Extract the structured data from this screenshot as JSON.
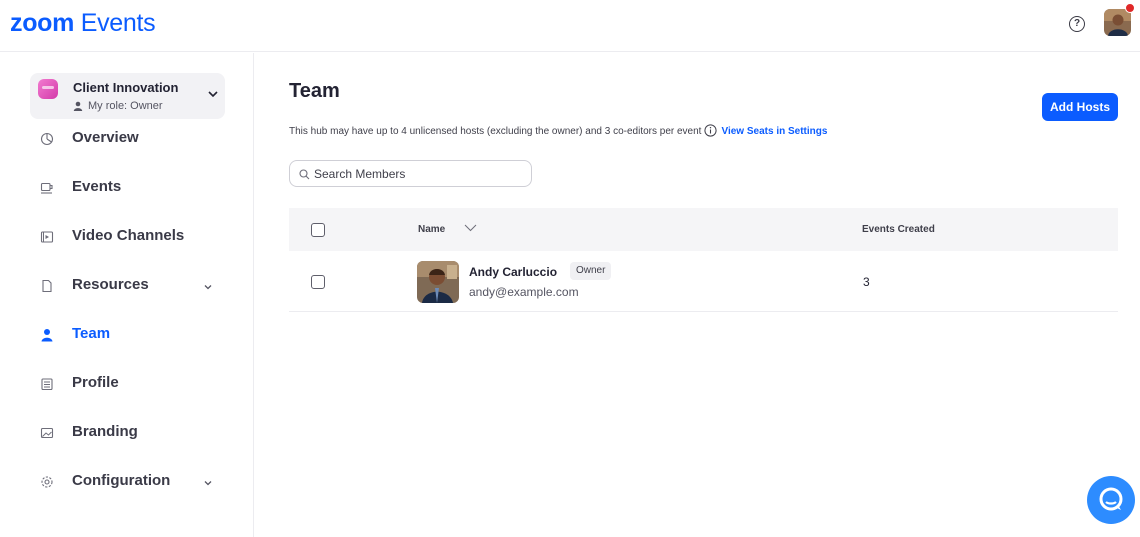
{
  "header": {
    "logo_zoom": "zoom",
    "logo_events": "Events",
    "help_icon": "question-mark",
    "has_notification": true
  },
  "sidebar": {
    "hub": {
      "name": "Client Innovation",
      "role": "My role: Owner"
    },
    "items": [
      {
        "label": "Overview",
        "icon": "pie-chart-icon",
        "active": false,
        "expandable": false
      },
      {
        "label": "Events",
        "icon": "coffee-cup-icon",
        "active": false,
        "expandable": false
      },
      {
        "label": "Video Channels",
        "icon": "video-channel-icon",
        "active": false,
        "expandable": false
      },
      {
        "label": "Resources",
        "icon": "document-icon",
        "active": false,
        "expandable": true
      },
      {
        "label": "Team",
        "icon": "person-icon",
        "active": true,
        "expandable": false
      },
      {
        "label": "Profile",
        "icon": "profile-list-icon",
        "active": false,
        "expandable": false
      },
      {
        "label": "Branding",
        "icon": "image-icon",
        "active": false,
        "expandable": false
      },
      {
        "label": "Configuration",
        "icon": "gear-icon",
        "active": false,
        "expandable": true
      }
    ]
  },
  "main": {
    "title": "Team",
    "add_hosts_label": "Add Hosts",
    "subtitle": "This hub may have up to 4 unlicensed hosts (excluding the owner) and 3 co-editors per event",
    "subtitle_link": "View Seats in Settings",
    "search_placeholder": "Search Members",
    "table": {
      "columns": [
        "Name",
        "Events Created"
      ],
      "rows": [
        {
          "name": "Andy Carluccio",
          "badge": "Owner",
          "email": "andy@example.com",
          "events_created": "3"
        }
      ]
    }
  },
  "colors": {
    "accent": "#0b5cff",
    "chat_button": "#2d8cff",
    "notification": "#e02828"
  }
}
